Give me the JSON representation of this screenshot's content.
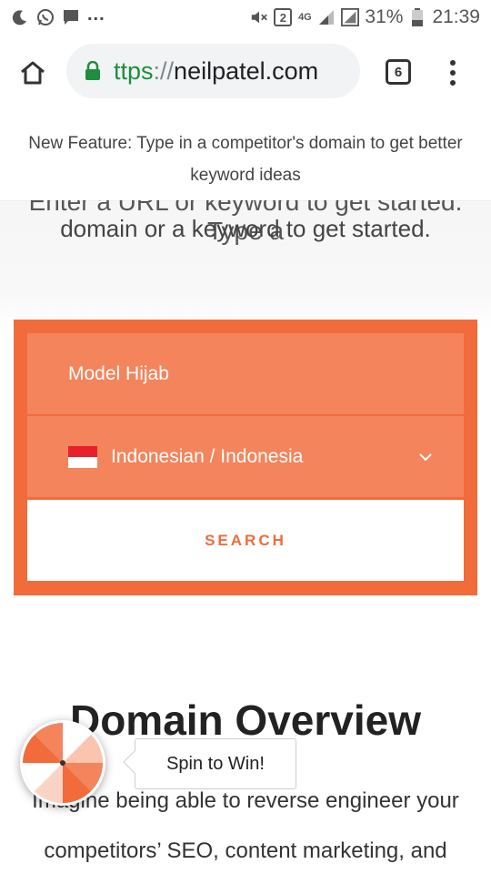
{
  "status_bar": {
    "notification_icons": [
      "moon-icon",
      "whatsapp-icon",
      "message-icon"
    ],
    "more": "...",
    "sim_badge": "2",
    "network": "4G",
    "battery": "31%",
    "time": "21:39"
  },
  "browser": {
    "url_scheme": "ttps",
    "url_sep": "://",
    "url_host": "neilpatel.com",
    "tab_count": "6",
    "secure_color": "#1e8e3e"
  },
  "banner": {
    "text": "New Feature: Type in a competitor's domain to get better keyword ideas"
  },
  "hero": {
    "partial_line": "Enter a URL or keyword to get started. Type a",
    "subtitle": "domain or a keyword to get started."
  },
  "search_form": {
    "keyword_value": "Model Hijab",
    "language_value": "Indonesian / Indonesia",
    "search_label": "SEARCH",
    "accent_color": "#f26b3a"
  },
  "section": {
    "title": "Domain Overview",
    "body_line1": "Imagine being able to reverse engineer your",
    "body_line2": "competitors’ SEO, content marketing, and"
  },
  "spin": {
    "label": "Spin to Win!"
  }
}
